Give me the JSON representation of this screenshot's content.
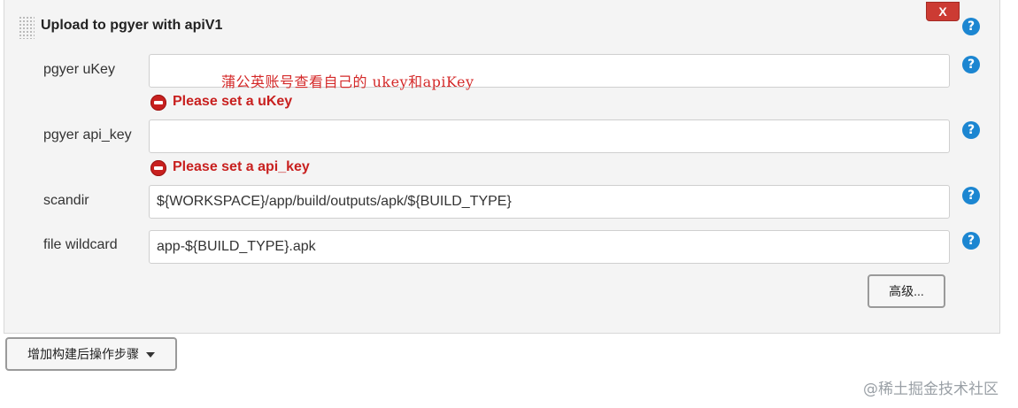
{
  "panel": {
    "title": "Upload to pgyer with apiV1",
    "close_label": "X"
  },
  "annotation": "蒲公英账号查看自己的 ukey和apiKey",
  "fields": [
    {
      "label": "pgyer uKey",
      "value": "",
      "error": "Please set a uKey"
    },
    {
      "label": "pgyer api_key",
      "value": "",
      "error": "Please set a api_key"
    },
    {
      "label": "scandir",
      "value": "${WORKSPACE}/app/build/outputs/apk/${BUILD_TYPE}"
    },
    {
      "label": "file wildcard",
      "value": "app-${BUILD_TYPE}.apk"
    }
  ],
  "help_glyph": "?",
  "advanced_label": "高级...",
  "add_step_label": "增加构建后操作步骤",
  "watermark": "@稀土掘金技术社区",
  "colors": {
    "help": "#1c86d1",
    "error": "#c8201f",
    "close": "#cc3b33",
    "annotation": "#d42a2a"
  }
}
